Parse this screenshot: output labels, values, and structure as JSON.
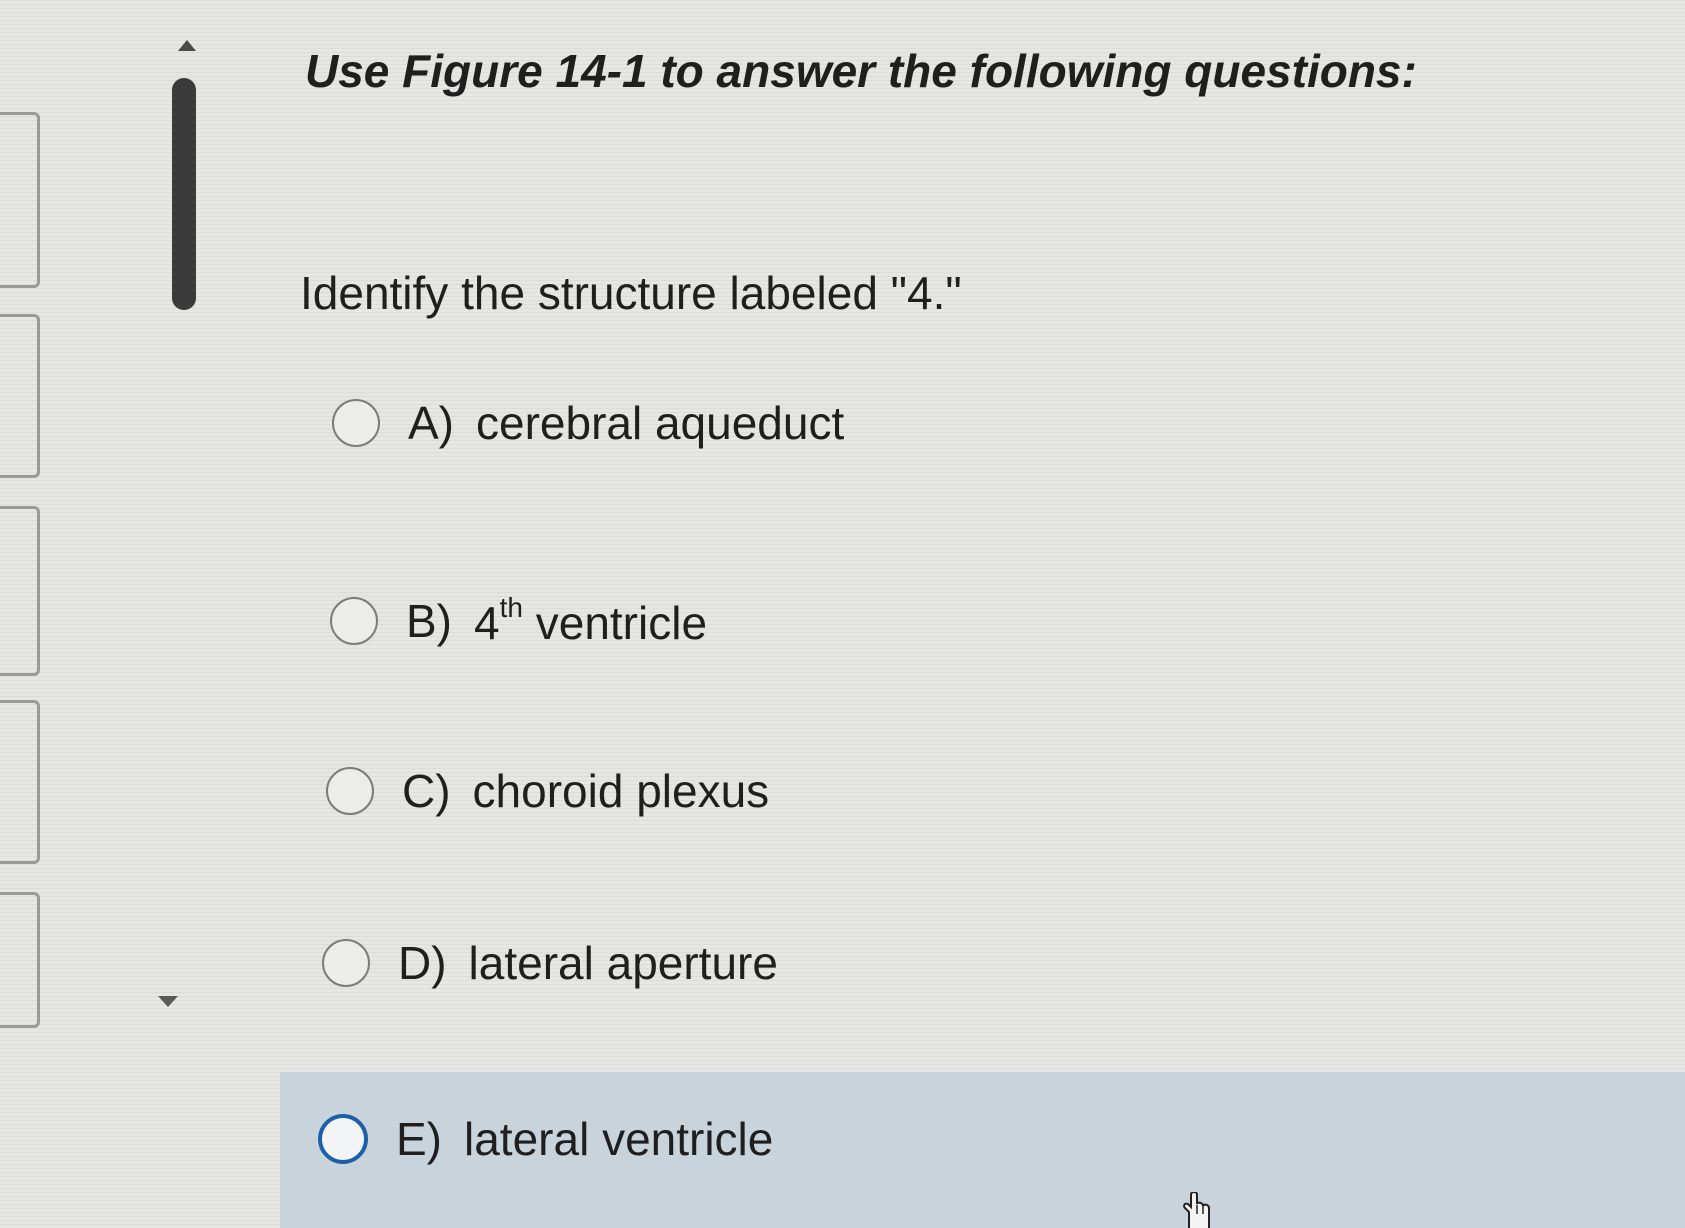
{
  "heading": "Use Figure 14-1 to answer the following questions:",
  "question": "Identify the structure labeled \"4.\"",
  "options": [
    {
      "letter": "A)",
      "text": "cerebral aqueduct"
    },
    {
      "letter": "B)",
      "text_prefix": "4",
      "text_sup": "th",
      "text_suffix": " ventricle"
    },
    {
      "letter": "C)",
      "text": "choroid plexus"
    },
    {
      "letter": "D)",
      "text": "lateral aperture"
    },
    {
      "letter": "E)",
      "text": "lateral ventricle"
    }
  ],
  "hovered_option": "E",
  "colors": {
    "highlight": "#c9d3dc",
    "radio_focus": "#1d5fa8"
  },
  "icons": {
    "cursor": "hand-pointer-icon",
    "scroll_up": "triangle-up-icon",
    "scroll_down": "triangle-down-icon"
  }
}
